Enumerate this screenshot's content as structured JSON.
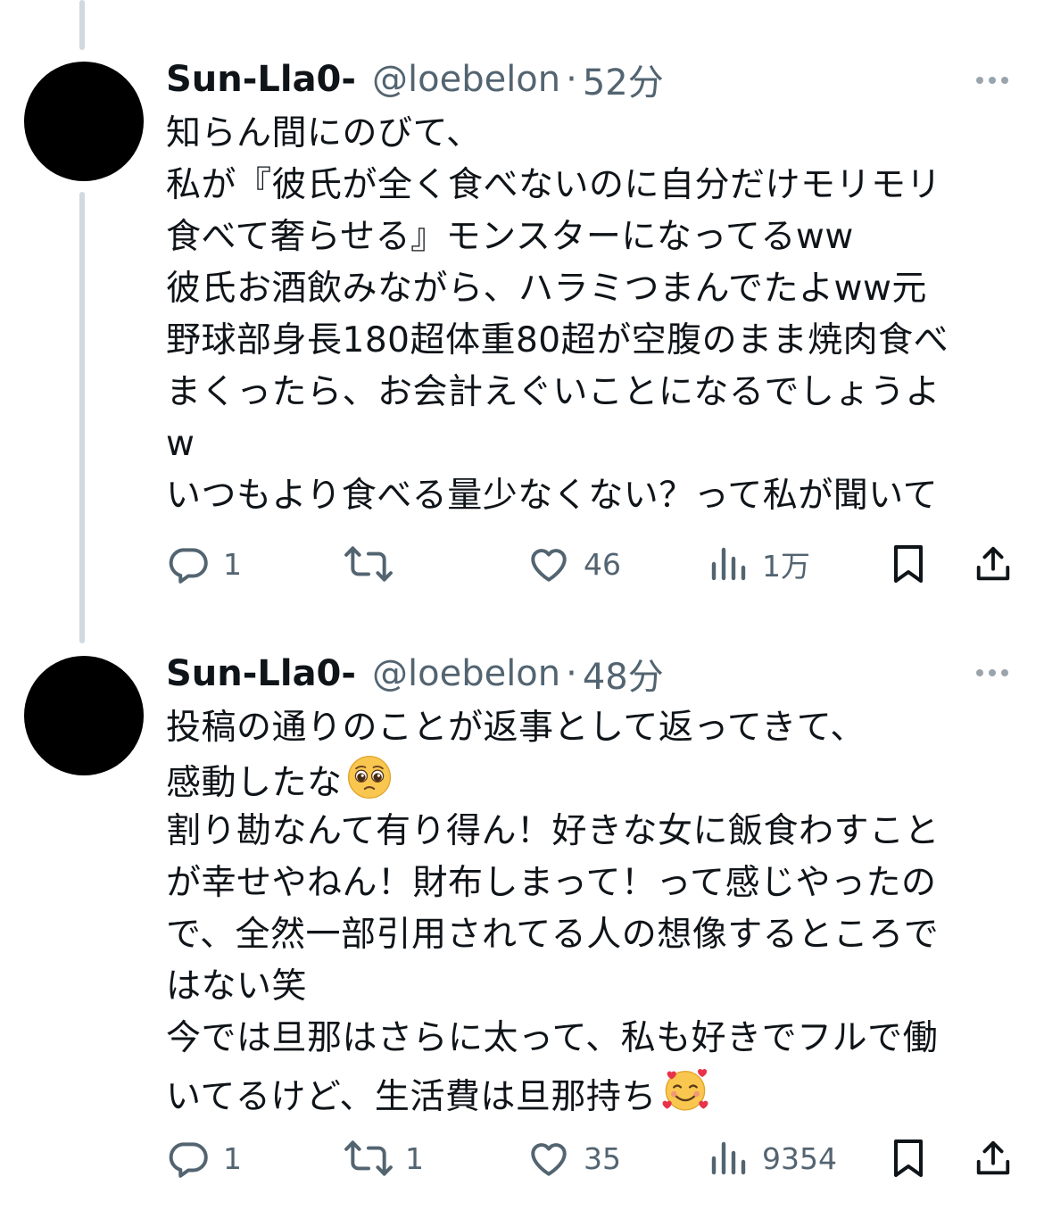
{
  "tweets": [
    {
      "name": "Sun-Lla0-",
      "handle": "@loebelon",
      "separator": "·",
      "time": "52分",
      "lines": [
        "知らん間にのびて、",
        "私が『彼氏が全く食べないのに自分だけモリモリ",
        "食べて奢らせる』モンスターになってるww",
        "彼氏お酒飲みながら、ハラミつまんでたよww元",
        "野球部身長180超体重80超が空腹のまま焼肉食べ",
        "まくったら、お会計えぐいことになるでしょうよ",
        "w",
        "いつもより食べる量少なくない？って私が聞いて"
      ],
      "emoji_last_line": "",
      "reply_count": "1",
      "retweet_count": "",
      "like_count": "46",
      "view_count": "1万"
    },
    {
      "name": "Sun-Lla0-",
      "handle": "@loebelon",
      "separator": "·",
      "time": "48分",
      "lines": [
        "投稿の通りのことが返事として返ってきて、",
        "感動したな",
        "割り勘なんて有り得ん！好きな女に飯食わすこと",
        "が幸せやねん！財布しまって！って感じやったの",
        "で、全然一部引用されてる人の想像するところで",
        "はない笑",
        "今では旦那はさらに太って、私も好きでフルで働",
        "いてるけど、生活費は旦那持ち"
      ],
      "reply_count": "1",
      "retweet_count": "1",
      "like_count": "35",
      "view_count": "9354"
    }
  ],
  "icons": {
    "reply": "reply-icon",
    "retweet": "retweet-icon",
    "like": "like-icon",
    "views": "views-icon",
    "bookmark": "bookmark-icon",
    "share": "share-icon",
    "more": "more-icon",
    "pleading_emoji": "pleading-face-emoji",
    "hearts_emoji": "smiling-face-with-hearts-emoji"
  },
  "colors": {
    "text": "#0f1419",
    "secondary": "#536471",
    "thread_line": "#cfd9de"
  }
}
